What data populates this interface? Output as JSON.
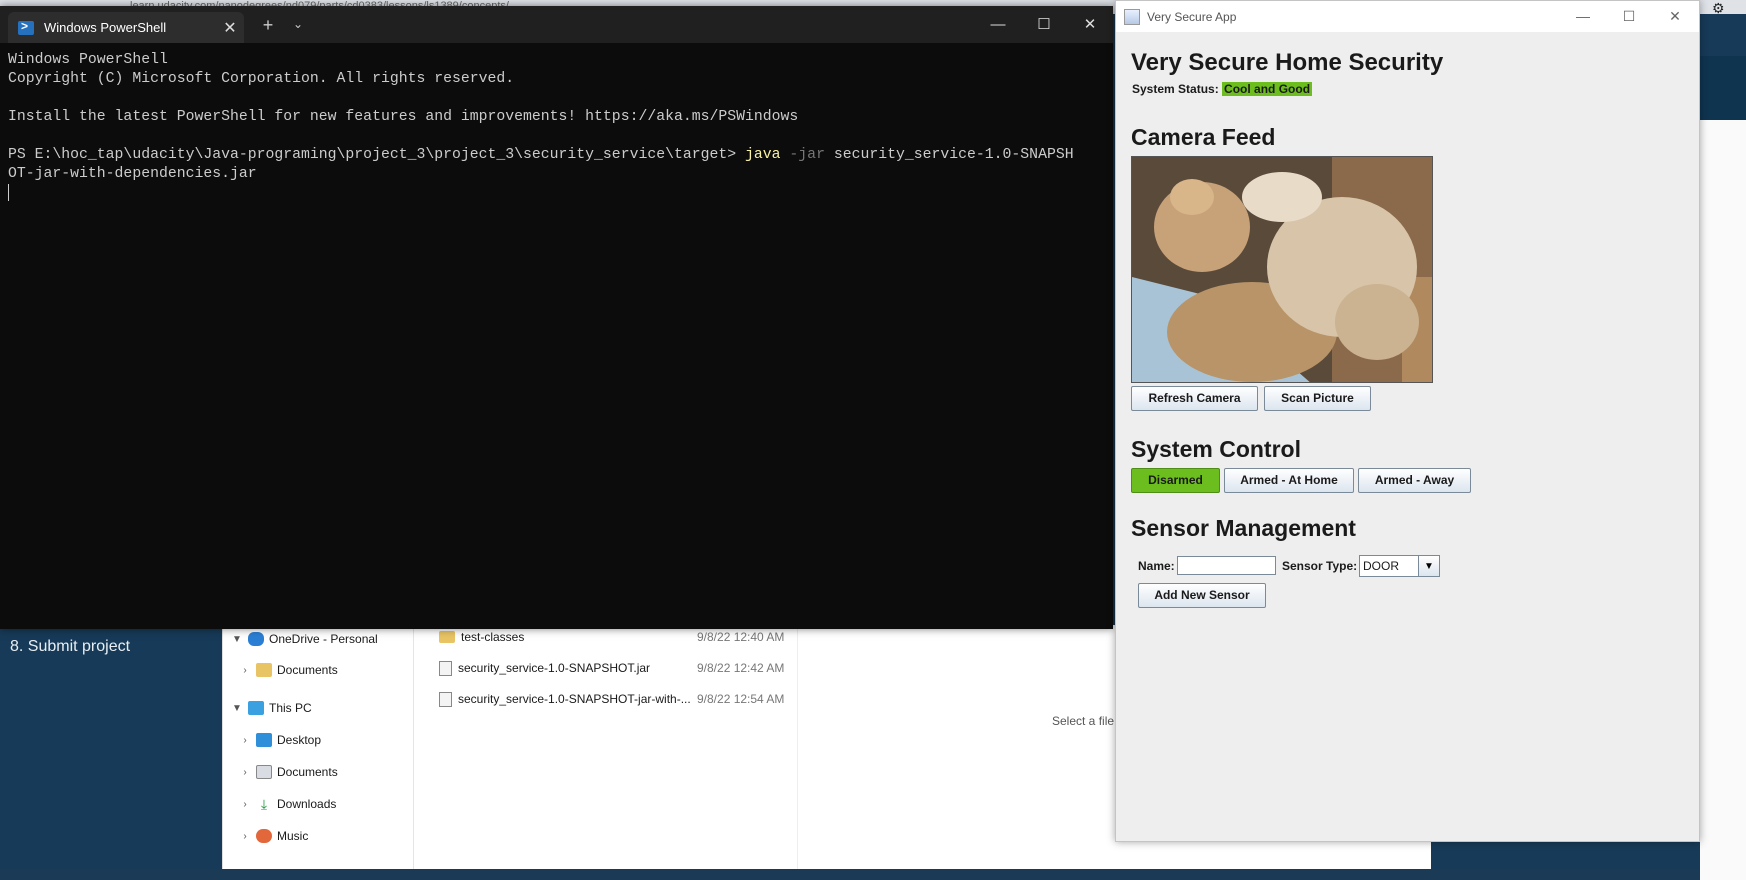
{
  "browser": {
    "url": "learn.udacity.com/nanodegrees/nd079/parts/cd0383/lessons/ls1389/concepts/...",
    "sidebar_item": "8. Submit project"
  },
  "powershell": {
    "tab_title": "Windows PowerShell",
    "new_tab": "+",
    "lines": {
      "l1": "Windows PowerShell",
      "l2": "Copyright (C) Microsoft Corporation. All rights reserved.",
      "l3": "Install the latest PowerShell for new features and improvements! https://aka.ms/PSWindows",
      "prompt": "PS E:\\hoc_tap\\udacity\\Java-programing\\project_3\\project_3\\security_service\\target> ",
      "cmd_java": "java",
      "cmd_flag": " -jar",
      "cmd_arg": " security_service-1.0-SNAPSH",
      "cmd_wrap": "OT-jar-with-dependencies.jar"
    }
  },
  "explorer": {
    "nav": [
      {
        "label": "OneDrive - Personal",
        "icon": "cloud-icon"
      },
      {
        "label": "Documents",
        "icon": "folder-icon"
      },
      {
        "label": "This PC",
        "icon": "computer-icon"
      },
      {
        "label": "Desktop",
        "icon": "desktop-icon"
      },
      {
        "label": "Documents",
        "icon": "documents-icon"
      },
      {
        "label": "Downloads",
        "icon": "downloads-icon"
      },
      {
        "label": "Music",
        "icon": "music-icon"
      }
    ],
    "files": [
      {
        "name": "test-classes",
        "date": "9/8/22 12:40 AM"
      },
      {
        "name": "security_service-1.0-SNAPSHOT.jar",
        "date": "9/8/22 12:42 AM"
      },
      {
        "name": "security_service-1.0-SNAPSHOT-jar-with-...",
        "date": "9/8/22 12:54 AM"
      }
    ],
    "preview_hint": "Select a file"
  },
  "app": {
    "window_title": "Very Secure App",
    "heading": "Very Secure Home Security",
    "status_label": "System Status: ",
    "status_value": "Cool and Good",
    "camera_heading": "Camera Feed",
    "refresh_button": "Refresh Camera",
    "scan_button": "Scan Picture",
    "control_heading": "System Control",
    "modes": {
      "disarmed": "Disarmed",
      "at_home": "Armed - At Home",
      "away": "Armed - Away"
    },
    "active_mode": "Disarmed",
    "sensor_heading": "Sensor Management",
    "name_label": "Name:",
    "name_value": "",
    "type_label": "Sensor Type:",
    "type_value": "DOOR",
    "add_sensor_button": "Add New Sensor"
  },
  "colors": {
    "status_green": "#6cbd1e",
    "terminal_bg": "#0c0c0c",
    "terminal_yellow": "#f9f1a5"
  }
}
